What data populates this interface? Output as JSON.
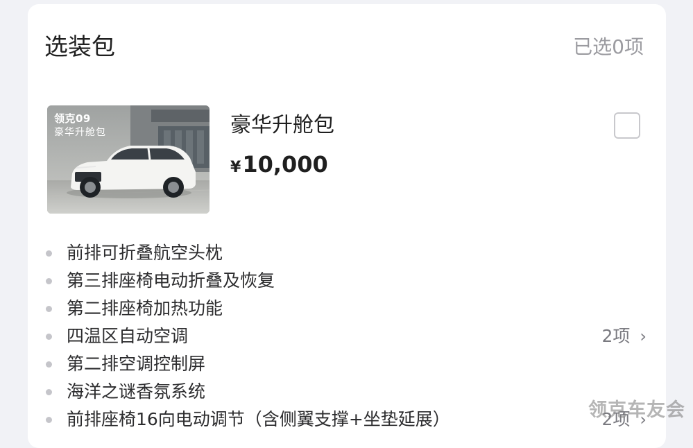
{
  "section": {
    "title": "选装包",
    "selected_count": "已选0项"
  },
  "package": {
    "image": {
      "brand_text": "领克09",
      "sub_text": "豪华升舱包"
    },
    "name": "豪华升舱包",
    "currency": "¥",
    "price": "10,000",
    "checkbox_checked": false
  },
  "features": [
    {
      "label": "前排可折叠航空头枕",
      "more": ""
    },
    {
      "label": "第三排座椅电动折叠及恢复",
      "more": ""
    },
    {
      "label": "第二排座椅加热功能",
      "more": ""
    },
    {
      "label": "四温区自动空调",
      "more": "2项"
    },
    {
      "label": "第二排空调控制屏",
      "more": ""
    },
    {
      "label": "海洋之谜香氛系统",
      "more": ""
    },
    {
      "label": "前排座椅16向电动调节（含侧翼支撑+坐垫延展）",
      "more": "2项"
    }
  ],
  "icons": {
    "more": "chevron-right-icon",
    "checkbox": "checkbox-unchecked-icon"
  },
  "colors": {
    "card_bg": "#ffffff",
    "page_bg": "#f1f2f6",
    "title_text": "#1f1f1f",
    "muted_text": "#9b9ba0",
    "bullet": "#c5c5ca"
  },
  "watermark": "领克车友会"
}
